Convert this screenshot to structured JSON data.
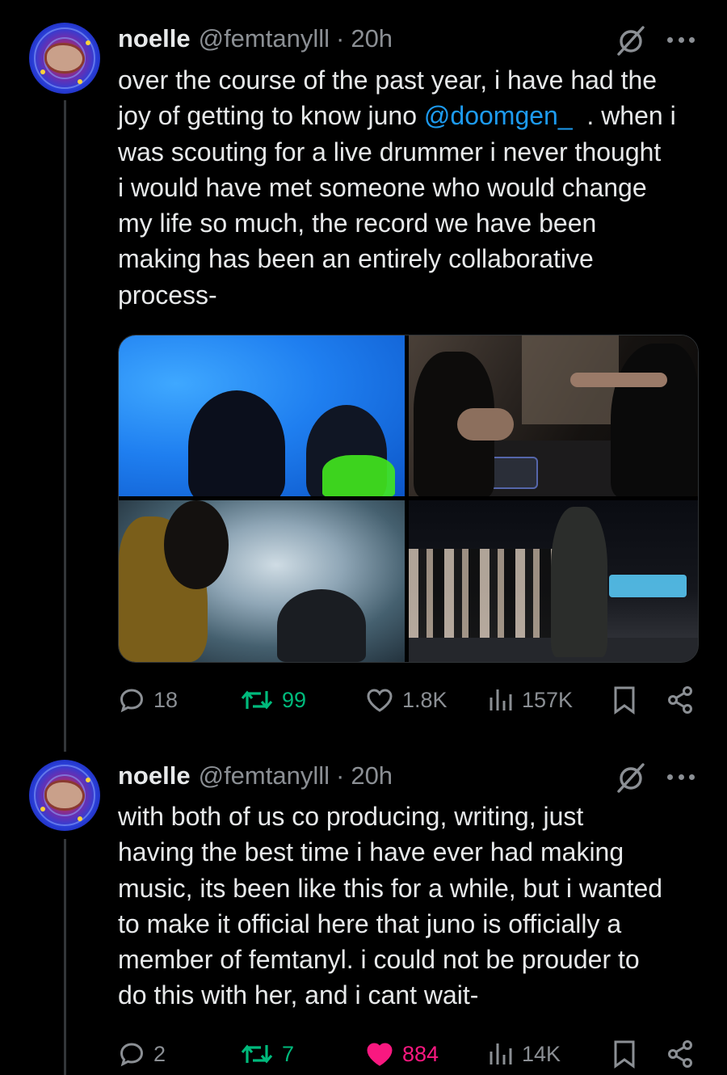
{
  "tweets": [
    {
      "author": {
        "name": "noelle",
        "handle": "@femtanylll",
        "time": "20h"
      },
      "text": {
        "line1": "over the course of the past year, i have had the",
        "line2_pre": "joy of getting to know juno ",
        "mention": "@doomgen_",
        "line2_post": "  . when i",
        "line3": "was scouting for a live drummer i never thought",
        "line4": "i would have met someone who would change",
        "line5": "my life so much, the record we have been",
        "line6": "making has been an entirely collaborative",
        "line7": "process-"
      },
      "media": {
        "photo_count": 4
      },
      "stats": {
        "replies": "18",
        "reposts": "99",
        "likes": "1.8K",
        "views": "157K"
      },
      "liked": false
    },
    {
      "author": {
        "name": "noelle",
        "handle": "@femtanylll",
        "time": "20h"
      },
      "text": {
        "line1": "with both of us co producing, writing, just",
        "line2": "having the best time i have ever had making",
        "line3": "music, its been like this for a while, but i wanted",
        "line4": "to make it official here that juno is officially a",
        "line5": "member of femtanyl. i could not be prouder to",
        "line6": "do this with her, and i cant wait-"
      },
      "stats": {
        "replies": "2",
        "reposts": "7",
        "likes": "884",
        "views": "14K"
      },
      "liked": true
    }
  ],
  "colors": {
    "background": "#000000",
    "text": "#e7e9ea",
    "muted": "#8b8f94",
    "mention": "#1d9bf0",
    "repost": "#00ba7c",
    "like": "#f91880"
  },
  "icons": [
    "reply-icon",
    "repost-icon",
    "like-icon",
    "views-icon",
    "bookmark-icon",
    "share-icon",
    "grok-icon",
    "more-icon"
  ]
}
